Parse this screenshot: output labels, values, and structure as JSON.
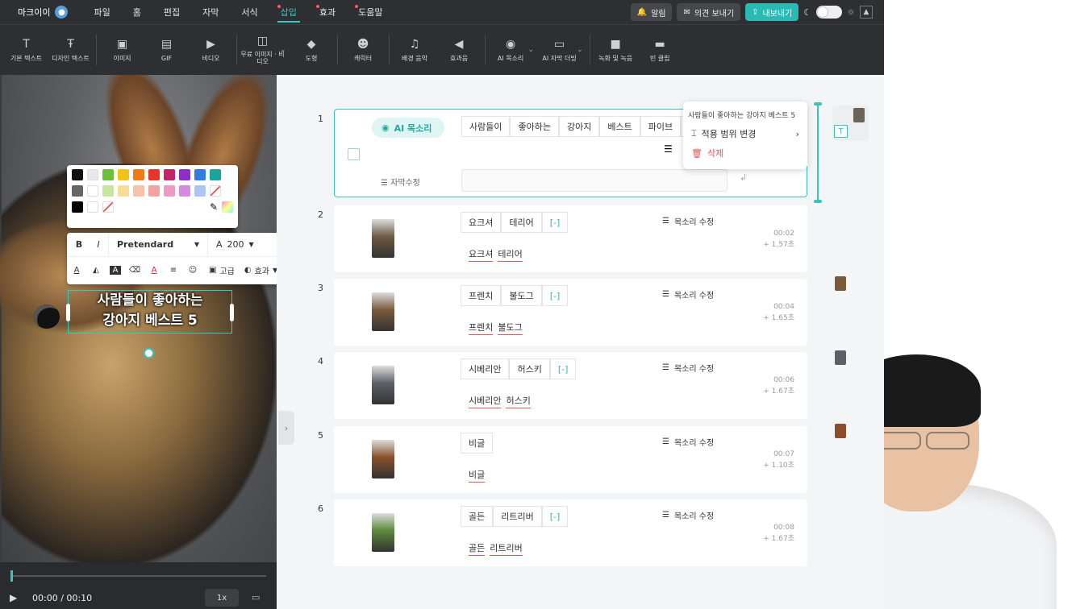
{
  "menubar": {
    "brand": "마크이이",
    "items": [
      {
        "label": "파일",
        "active": false,
        "dot": false
      },
      {
        "label": "홈",
        "active": false,
        "dot": false
      },
      {
        "label": "편집",
        "active": false,
        "dot": false
      },
      {
        "label": "자막",
        "active": false,
        "dot": false
      },
      {
        "label": "서식",
        "active": false,
        "dot": false
      },
      {
        "label": "삽입",
        "active": true,
        "dot": true
      },
      {
        "label": "효과",
        "active": false,
        "dot": true
      },
      {
        "label": "도움말",
        "active": false,
        "dot": true
      }
    ],
    "alarm": "알림",
    "feedback": "의견 보내기",
    "export": "내보내기"
  },
  "toolbar": {
    "items": [
      {
        "label": "기본 텍스트",
        "icon": "text-icon"
      },
      {
        "label": "디자인 텍스트",
        "icon": "design-text-icon"
      },
      {
        "label": "이미지",
        "icon": "image-icon"
      },
      {
        "label": "GIF",
        "icon": "gif-icon"
      },
      {
        "label": "비디오",
        "icon": "video-icon"
      },
      {
        "label": "무료 이미지 · 비디오",
        "icon": "free-media-icon"
      },
      {
        "label": "도형",
        "icon": "shape-icon"
      },
      {
        "label": "캐릭터",
        "icon": "character-icon"
      },
      {
        "label": "배경 음악",
        "icon": "music-icon"
      },
      {
        "label": "효과음",
        "icon": "sound-effect-icon"
      },
      {
        "label": "AI 목소리",
        "icon": "ai-voice-icon"
      },
      {
        "label": "AI 자막 더빙",
        "icon": "ai-dubbing-icon"
      },
      {
        "label": "녹화 및 녹음",
        "icon": "record-icon"
      },
      {
        "label": "빈 클립",
        "icon": "empty-clip-icon"
      }
    ]
  },
  "palette": {
    "row1": [
      "#111111",
      "#e8e8e8",
      "#6bbf3a",
      "#f2c21b",
      "#f07a18",
      "#e8352b",
      "#c4246a",
      "#8e2fc9",
      "#2f7de1",
      "#1ba39c"
    ],
    "row2": [
      "#666666",
      "#ffffff",
      "#c8e6a0",
      "#f7dc9a",
      "#f7c2a8",
      "#f4a3a3",
      "#ee9ac2",
      "#d68be0",
      "#a9c7f2"
    ],
    "row3": [
      "#000000",
      "#ffffff"
    ]
  },
  "format": {
    "bold": "B",
    "italic": "I",
    "font": "Pretendard",
    "size": "200",
    "advanced": "고급",
    "effect": "효과"
  },
  "caption": {
    "line1": "사람들이 좋아하는",
    "line2": "강아지 베스트 5"
  },
  "player": {
    "time": "00:00 / 00:10",
    "speed": "1x",
    "progress": 0
  },
  "scenes": [
    {
      "num": "1",
      "ai_voice": "AI 목소리",
      "chips": [
        "사람들이",
        "좋아하는",
        "강아지",
        "베스트",
        "파이브",
        "[-"
      ],
      "edit_label": "자막수정"
    },
    {
      "num": "2",
      "chips": [
        "요크셔",
        "테리어",
        "[-]"
      ],
      "words": [
        "요크셔",
        "테리어"
      ],
      "voice": "목소리 수정",
      "time": "00:02",
      "dur": "+ 1.57초",
      "color": "#6d5a44"
    },
    {
      "num": "3",
      "chips": [
        "프렌치",
        "불도그",
        "[-]"
      ],
      "words": [
        "프렌치",
        "불도그"
      ],
      "voice": "목소리 수정",
      "time": "00:04",
      "dur": "+ 1.65초",
      "color": "#7a5a3a"
    },
    {
      "num": "4",
      "chips": [
        "시베리안",
        "허스키",
        "[-]"
      ],
      "words": [
        "시베리안",
        "허스키"
      ],
      "voice": "목소리 수정",
      "time": "00:06",
      "dur": "+ 1.67초",
      "color": "#5e6068"
    },
    {
      "num": "5",
      "chips": [
        "비글"
      ],
      "words": [
        "비글"
      ],
      "voice": "목소리 수정",
      "time": "00:07",
      "dur": "+ 1.10초",
      "color": "#8a4f2a"
    },
    {
      "num": "6",
      "chips": [
        "골든",
        "리트리버",
        "[-]"
      ],
      "words": [
        "골든",
        "리트리버"
      ],
      "voice": "목소리 수정",
      "time": "00:08",
      "dur": "+ 1.67초",
      "color": "#5c8a3a"
    }
  ],
  "popup": {
    "title": "사람들이 좋아하는 강아지 베스트 5",
    "scope": "적용 범위 변경",
    "delete": "삭제"
  }
}
